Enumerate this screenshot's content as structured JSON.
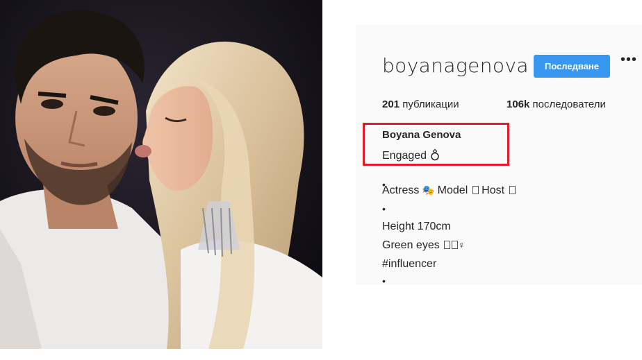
{
  "profile": {
    "username": "boyanagenova",
    "follow_label": "Последване",
    "more_label": "•••",
    "stats": {
      "posts_count": "201",
      "posts_label": "публикации",
      "followers_count": "106k",
      "followers_label": "последователи"
    },
    "full_name": "Boyana Genova",
    "bio": {
      "status": "Engaged ",
      "status_emoji": "ring",
      "bullet": "•",
      "roles": [
        "Actress ",
        " Model ",
        " Host "
      ],
      "height": "Height 170cm",
      "eyes": "Green eyes ",
      "hashtag": "#influencer"
    }
  },
  "colors": {
    "follow_button": "#3897f0",
    "highlight_box": "#e11b2a",
    "text": "#262626",
    "panel_background": "#fafafa"
  }
}
